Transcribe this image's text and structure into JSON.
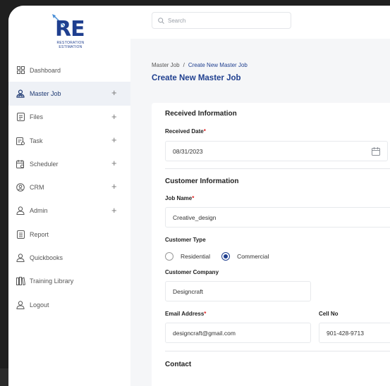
{
  "brand": {
    "letters": "RE",
    "tagline": "RESTORATION ESTIMATION",
    "color": "#1f3f8f"
  },
  "sidebar": {
    "items": [
      {
        "label": "Dashboard",
        "icon": "dashboard-icon",
        "has_plus": false
      },
      {
        "label": "Master Job",
        "icon": "master-job-icon",
        "has_plus": true,
        "active": true
      },
      {
        "label": "Files",
        "icon": "files-icon",
        "has_plus": true
      },
      {
        "label": "Task",
        "icon": "task-icon",
        "has_plus": true
      },
      {
        "label": "Scheduler",
        "icon": "calendar-icon",
        "has_plus": true
      },
      {
        "label": "CRM",
        "icon": "crm-icon",
        "has_plus": true
      },
      {
        "label": "Admin",
        "icon": "user-icon",
        "has_plus": true
      },
      {
        "label": "Report",
        "icon": "report-icon",
        "has_plus": false
      },
      {
        "label": "Quickbooks",
        "icon": "user-icon",
        "has_plus": false
      },
      {
        "label": "Training Library",
        "icon": "library-icon",
        "has_plus": false
      },
      {
        "label": "Logout",
        "icon": "user-icon",
        "has_plus": false
      }
    ],
    "plus_symbol": "+"
  },
  "search": {
    "placeholder": "Search"
  },
  "breadcrumb": {
    "root": "Master Job",
    "separator": "/",
    "current": "Create New Master Job"
  },
  "page_title": "Create New Master Job",
  "form": {
    "received_section": "Received Information",
    "received_date_label": "Received Date",
    "received_date_value": "08/31/2023",
    "customer_section": "Customer Information",
    "job_name_label": "Job Name",
    "job_name_value": "Creative_design",
    "customer_type_label": "Customer Type",
    "customer_type_options": [
      "Residential",
      "Commercial"
    ],
    "customer_type_selected": "Commercial",
    "customer_company_label": "Customer Company",
    "customer_company_value": "Designcraft",
    "email_label": "Email Address",
    "email_value": "designcraft@gmail.com",
    "cell_label": "Cell No",
    "cell_value": "901-428-9713",
    "contact_section": "Contact",
    "required_mark": "*"
  }
}
